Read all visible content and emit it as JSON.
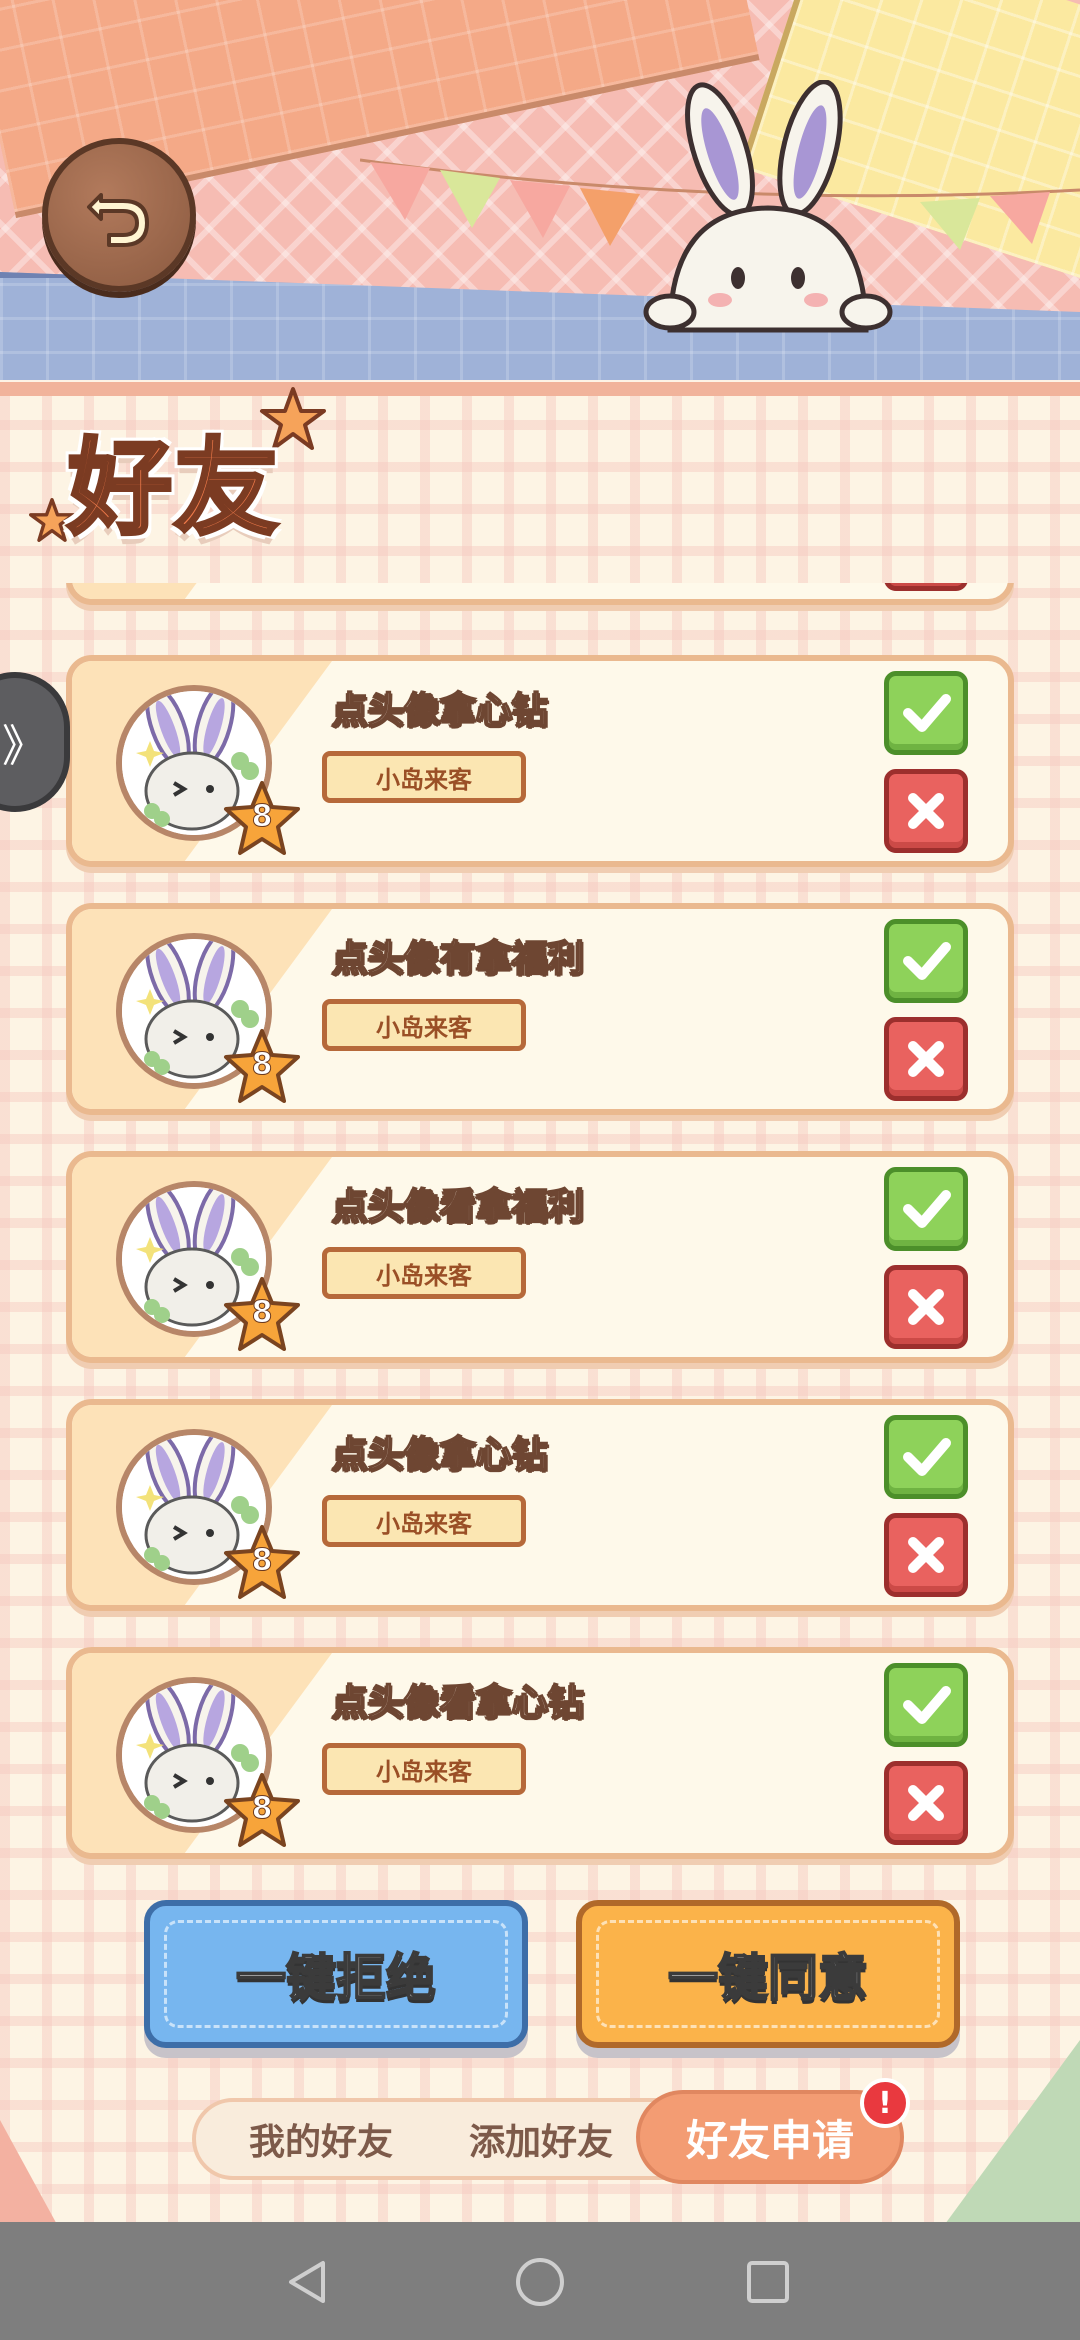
{
  "header": {
    "back_icon": "back-arrow-icon",
    "mascot": "bunny-icon"
  },
  "page": {
    "title": "好友"
  },
  "requests": [
    {
      "name": "点头像拿心钻",
      "tag": "小岛来客",
      "level": "8"
    },
    {
      "name": "点头像有拿福利",
      "tag": "小岛来客",
      "level": "8"
    },
    {
      "name": "点头像看拿福利",
      "tag": "小岛来客",
      "level": "8"
    },
    {
      "name": "点头像拿心钻",
      "tag": "小岛来客",
      "level": "8"
    },
    {
      "name": "点头像看拿心钻",
      "tag": "小岛来客",
      "level": "8"
    }
  ],
  "actions": {
    "reject_all": "一键拒绝",
    "accept_all": "一键同意"
  },
  "tabs": {
    "my_friends": "我的好友",
    "add_friend": "添加好友",
    "friend_requests": "好友申请",
    "alert": "!"
  },
  "side": {
    "handle_icon": "》"
  },
  "colors": {
    "accept": "#8ed25a",
    "reject": "#e9625f",
    "accent": "#f39c73",
    "reject_all": "#77b6ef",
    "accept_all": "#fbb34a"
  }
}
